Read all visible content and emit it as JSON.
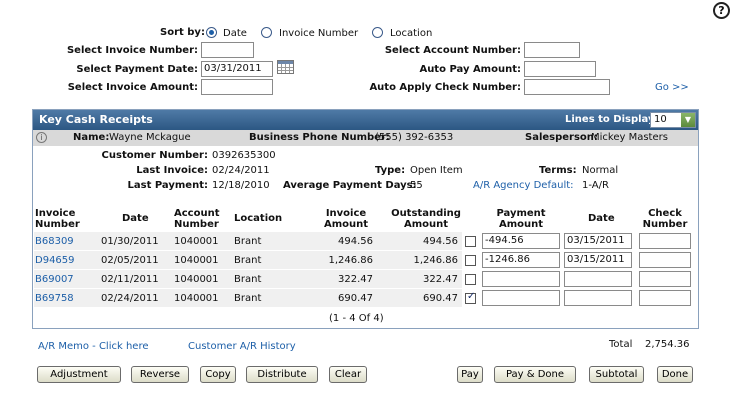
{
  "help": {
    "icon": "question-circle-icon",
    "glyph": "?"
  },
  "filters": {
    "sort_by_label": "Sort by:",
    "sort_options": [
      "Date",
      "Invoice Number",
      "Location"
    ],
    "sort_selected": "Date",
    "invoice_number_label": "Select Invoice Number:",
    "payment_date_label": "Select Payment Date:",
    "payment_date_value": "03/31/2011",
    "invoice_amount_label": "Select Invoice Amount:",
    "account_number_label": "Select Account Number:",
    "auto_pay_label": "Auto Pay Amount:",
    "auto_apply_label": "Auto Apply Check Number:",
    "go_label": "Go >>"
  },
  "panel": {
    "title": "Key Cash Receipts",
    "lines_label": "Lines to Display:",
    "lines_value": "10",
    "name_label": "Name:",
    "name_value": "Wayne Mckague",
    "phone_label": "Business Phone Number:",
    "phone_value": "(555) 392-6353",
    "sales_label": "Salesperson:",
    "sales_value": "Mickey Masters",
    "customer_number_label": "Customer Number:",
    "customer_number_value": "0392635300",
    "last_invoice_label": "Last Invoice:",
    "last_invoice_value": "02/24/2011",
    "type_label": "Type:",
    "type_value": "Open Item",
    "terms_label": "Terms:",
    "terms_value": "Normal",
    "last_payment_label": "Last Payment:",
    "last_payment_value": "12/18/2010",
    "avg_days_label": "Average Payment Days:",
    "avg_days_value": "55",
    "agency_label": "A/R Agency Default:",
    "agency_value": "1-A/R",
    "headers": {
      "invoice_number": [
        "Invoice",
        "Number"
      ],
      "date": "Date",
      "account_number": [
        "Account",
        "Number"
      ],
      "location": "Location",
      "invoice_amount": [
        "Invoice",
        "Amount"
      ],
      "outstanding_amount": [
        "Outstanding",
        "Amount"
      ],
      "payment_amount": [
        "Payment",
        "Amount"
      ],
      "pay_date": "Date",
      "check_number": [
        "Check",
        "Number"
      ]
    },
    "rows": [
      {
        "invoice": "B68309",
        "date": "01/30/2011",
        "account": "1040001",
        "location": "Brant",
        "amount": "494.56",
        "outstanding": "494.56",
        "checked": false,
        "payment": "-494.56",
        "pay_date": "03/15/2011",
        "check": ""
      },
      {
        "invoice": "D94659",
        "date": "02/05/2011",
        "account": "1040001",
        "location": "Brant",
        "amount": "1,246.86",
        "outstanding": "1,246.86",
        "checked": false,
        "payment": "-1246.86",
        "pay_date": "03/15/2011",
        "check": ""
      },
      {
        "invoice": "B69007",
        "date": "02/11/2011",
        "account": "1040001",
        "location": "Brant",
        "amount": "322.47",
        "outstanding": "322.47",
        "checked": false,
        "payment": "",
        "pay_date": "",
        "check": ""
      },
      {
        "invoice": "B69758",
        "date": "02/24/2011",
        "account": "1040001",
        "location": "Brant",
        "amount": "690.47",
        "outstanding": "690.47",
        "checked": true,
        "payment": "",
        "pay_date": "",
        "check": ""
      }
    ],
    "pager": "(1 - 4 Of 4)"
  },
  "footer": {
    "memo_link": "A/R Memo - Click here",
    "history_link": "Customer A/R History",
    "total_label": "Total",
    "total_value": "2,754.36"
  },
  "buttons": {
    "adjustment": "Adjustment",
    "reverse": "Reverse",
    "copy": "Copy",
    "distribute": "Distribute",
    "clear": "Clear",
    "pay": "Pay",
    "pay_done": "Pay & Done",
    "subtotal": "Subtotal",
    "done": "Done"
  }
}
